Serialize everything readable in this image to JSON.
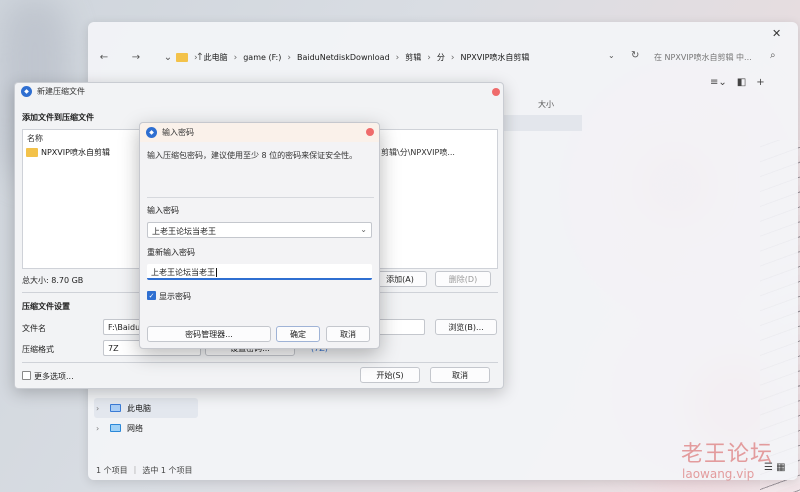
{
  "explorer": {
    "close_glyph": "✕",
    "nav": [
      "←",
      "→",
      "⌄",
      "↑"
    ],
    "breadcrumbs": [
      "此电脑",
      "game (F:)",
      "BaiduNetdiskDownload",
      "剪辑",
      "分",
      "NPXVIP喷水自剪辑"
    ],
    "search_placeholder": "在 NPXVIP喷水自剪辑 中...",
    "column_size": "大小",
    "tree": [
      {
        "label": "此电脑",
        "selected": true
      },
      {
        "label": "网络",
        "selected": false
      }
    ],
    "status_count": "1 个项目",
    "status_selected": "选中 1 个项目"
  },
  "compress": {
    "title": "新建压缩文件",
    "section_add": "添加文件到压缩文件",
    "list_header_name": "名称",
    "file_name": "NPXVIP喷水自剪辑",
    "file_path_partial": "剪辑\\分\\NPXVIP喷...",
    "total_size": "总大小: 8.70 GB",
    "add_button": "添加(A)",
    "delete_button": "删除(D)",
    "section_settings": "压缩文件设置",
    "filename_label": "文件名",
    "filename_value": "F:\\BaiduN",
    "browse_button": "浏览(B)...",
    "format_label": "压缩格式",
    "format_value": "7Z",
    "hidden_button_fragment": "设置密码...",
    "hidden_link_fragment": "(7Z)",
    "more_options": "更多选项...",
    "start_button": "开始(S)",
    "cancel_button": "取消"
  },
  "password": {
    "title": "输入密码",
    "hint": "输入压缩包密码，建议使用至少 8 位的密码来保证安全性。",
    "password_label": "输入密码",
    "password_value": "上老王论坛当老王",
    "reenter_label": "重新输入密码",
    "reenter_value": "上老王论坛当老王",
    "show_password": "显示密码",
    "show_password_checked": true,
    "manager_button": "密码管理器...",
    "ok_button": "确定",
    "cancel_button": "取消"
  },
  "watermark": {
    "line1": "老王论坛",
    "line2": "laowang.vip"
  },
  "colors": {
    "accent": "#2f6fd1",
    "close": "#ef6b6b",
    "watermark": "#d65454"
  }
}
